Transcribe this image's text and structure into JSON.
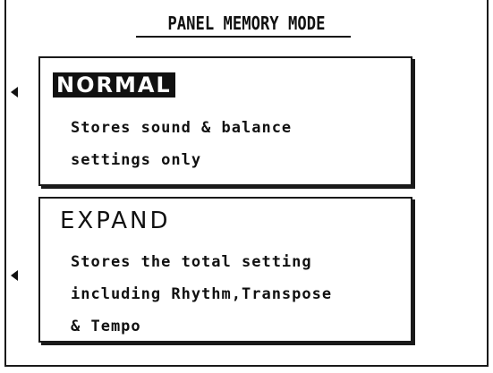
{
  "screen": {
    "title": "PANEL MEMORY MODE"
  },
  "options": [
    {
      "label": "NORMAL",
      "selected": true,
      "description_lines": [
        "Stores sound & balance",
        "settings only"
      ]
    },
    {
      "label": "EXPAND",
      "selected": false,
      "description_lines": [
        "Stores the total setting",
        "including Rhythm,Transpose",
        "& Tempo"
      ]
    }
  ],
  "icons": {
    "option_selector": "left-triangle-icon"
  },
  "colors": {
    "foreground": "#111111",
    "background": "#ffffff"
  }
}
